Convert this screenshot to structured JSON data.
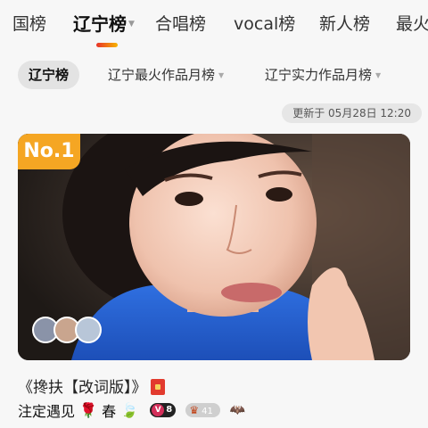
{
  "top_tabs": [
    {
      "label": "国榜"
    },
    {
      "label": "辽宁榜",
      "active": true
    },
    {
      "label": "合唱榜"
    },
    {
      "label": "vocal榜"
    },
    {
      "label": "新人榜"
    },
    {
      "label": "最火"
    }
  ],
  "sub_tabs": [
    {
      "label": "辽宁榜",
      "active": true
    },
    {
      "label": "辽宁最火作品月榜"
    },
    {
      "label": "辽宁实力作品月榜"
    }
  ],
  "update_text": "更新于 05月28日 12:20",
  "card": {
    "rank": "No.1"
  },
  "song": {
    "title": "《搀扶【改词版】》",
    "author": "注定遇见",
    "author_suffix": "春",
    "vip_level": "8",
    "level": "41"
  },
  "colors": {
    "accent_start": "#e8322a",
    "accent_end": "#f7b500",
    "rank_badge": "#f5a623"
  }
}
